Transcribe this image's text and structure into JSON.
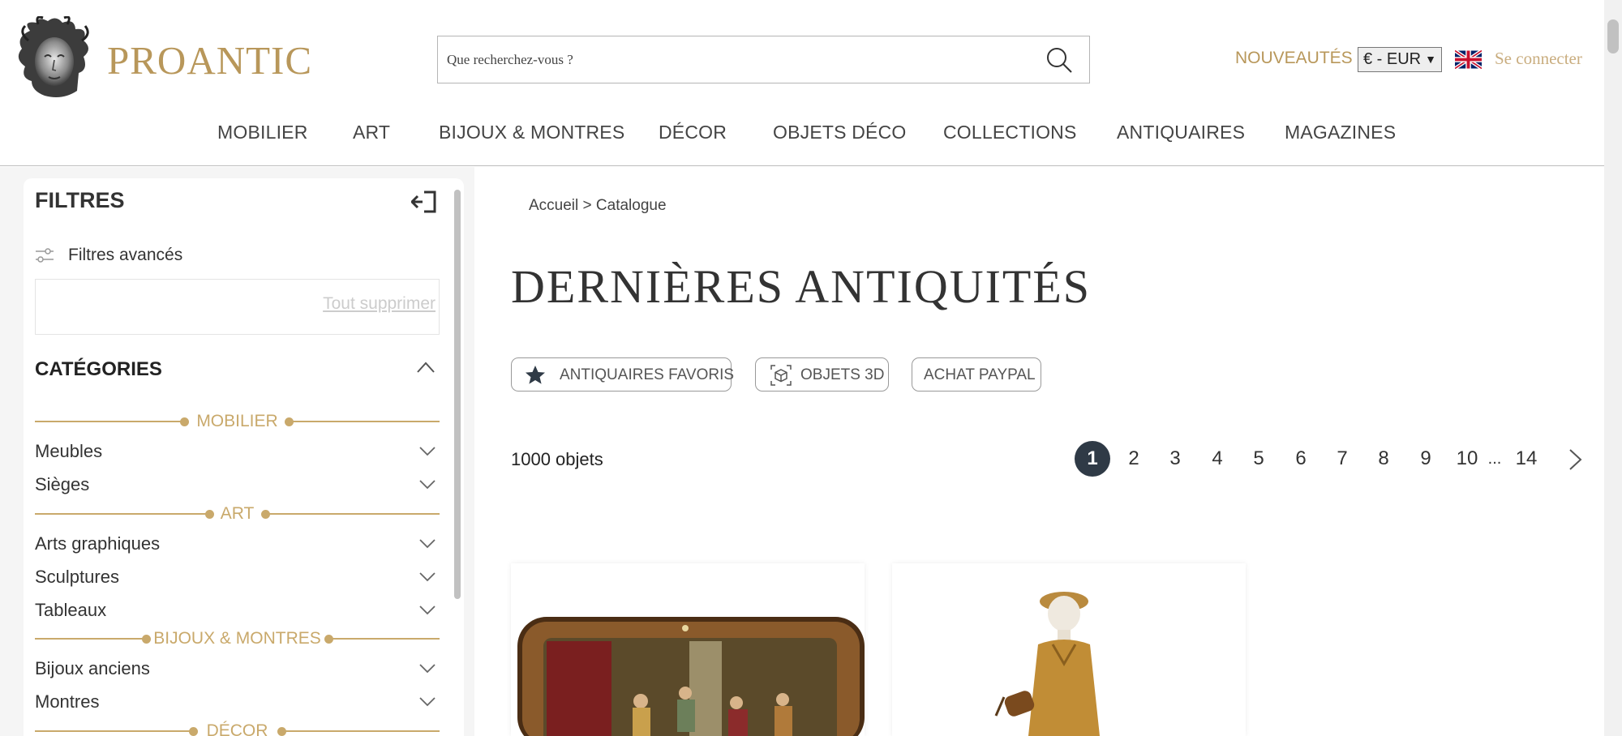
{
  "header": {
    "logo_text": "PROANTIC",
    "search_placeholder": "Que recherchez-vous ?",
    "nouveautes": "NOUVEAUTÉS",
    "currency": "€ - EUR",
    "signin": "Se connecter"
  },
  "nav": [
    {
      "label": "MOBILIER"
    },
    {
      "label": "ART"
    },
    {
      "label": "BIJOUX & MONTRES"
    },
    {
      "label": "DÉCOR"
    },
    {
      "label": "OBJETS DÉCO"
    },
    {
      "label": "COLLECTIONS"
    },
    {
      "label": "ANTIQUAIRES"
    },
    {
      "label": "MAGAZINES"
    }
  ],
  "sidebar": {
    "title": "FILTRES",
    "advanced": "Filtres avancés",
    "clear_all": "Tout supprimer",
    "categories_title": "CATÉGORIES",
    "sections": [
      {
        "label": "MOBILIER",
        "items": [
          "Meubles",
          "Sièges"
        ]
      },
      {
        "label": "ART",
        "items": [
          "Arts graphiques",
          "Sculptures",
          "Tableaux"
        ]
      },
      {
        "label": "BIJOUX & MONTRES",
        "items": [
          "Bijoux anciens",
          "Montres"
        ]
      },
      {
        "label": "DÉCOR",
        "items": []
      }
    ]
  },
  "main": {
    "breadcrumb": "Accueil > Catalogue",
    "title": "DERNIÈRES ANTIQUITÉS",
    "pills": [
      "ANTIQUAIRES FAVORIS",
      "OBJETS 3D",
      "ACHAT PAYPAL"
    ],
    "count": "1000 objets",
    "pages": [
      "1",
      "2",
      "3",
      "4",
      "5",
      "6",
      "7",
      "8",
      "9",
      "10"
    ],
    "ellipsis": "...",
    "last_page": "14"
  },
  "colors": {
    "gold": "#b8975a",
    "pager_active": "#2f3a46"
  }
}
